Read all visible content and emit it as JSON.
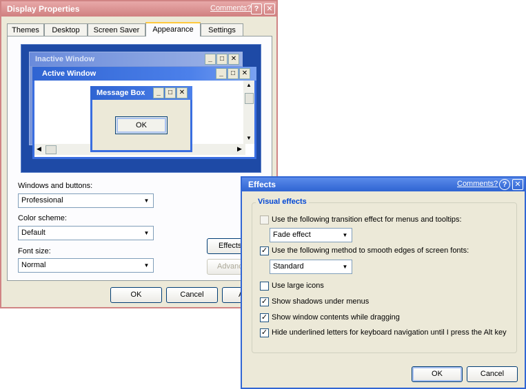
{
  "display": {
    "title": "Display Properties",
    "comments": "Comments?",
    "help_glyph": "?",
    "close_glyph": "✕",
    "tabs": [
      {
        "label": "Themes"
      },
      {
        "label": "Desktop"
      },
      {
        "label": "Screen Saver"
      },
      {
        "label": "Appearance"
      },
      {
        "label": "Settings"
      }
    ],
    "preview": {
      "inactive_title": "Inactive Window",
      "active_title": "Active Window",
      "message_title": "Message Box",
      "ok": "OK"
    },
    "windows_buttons_label": "Windows and buttons:",
    "windows_buttons_value": "Professional",
    "color_scheme_label": "Color scheme:",
    "color_scheme_value": "Default",
    "font_size_label": "Font size:",
    "font_size_value": "Normal",
    "effects_button": "Effects",
    "advanced_button": "Advanc",
    "ok": "OK",
    "cancel": "Cancel",
    "apply_partial": "A"
  },
  "effects": {
    "title": "Effects",
    "comments": "Comments?",
    "help_glyph": "?",
    "close_glyph": "✕",
    "group_label": "Visual effects",
    "transition": {
      "label": "Use the following transition effect for menus and tooltips:",
      "checked": false
    },
    "transition_value": "Fade effect",
    "smooth": {
      "label": "Use the following method to smooth edges of screen fonts:",
      "checked": true
    },
    "smooth_value": "Standard",
    "large_icons": {
      "label": "Use large icons",
      "checked": false
    },
    "shadows": {
      "label": "Show shadows under menus",
      "checked": true
    },
    "drag_contents": {
      "label": "Show window contents while dragging",
      "checked": true
    },
    "hide_underline": {
      "label": "Hide underlined letters for keyboard navigation until I press the Alt key",
      "checked": true
    },
    "ok": "OK",
    "cancel": "Cancel"
  },
  "glyphs": {
    "check": "✓",
    "dropdown_arrow": "▼",
    "minimize": "_",
    "maximize": "□",
    "close": "✕",
    "scroll_up": "▲",
    "scroll_down": "▼",
    "scroll_left": "◀",
    "scroll_right": "▶"
  },
  "colors": {
    "display_frame": "#d08484",
    "effects_frame": "#3166d4",
    "preview_bg": "#1e4aa6",
    "group_label": "#0046d5"
  }
}
